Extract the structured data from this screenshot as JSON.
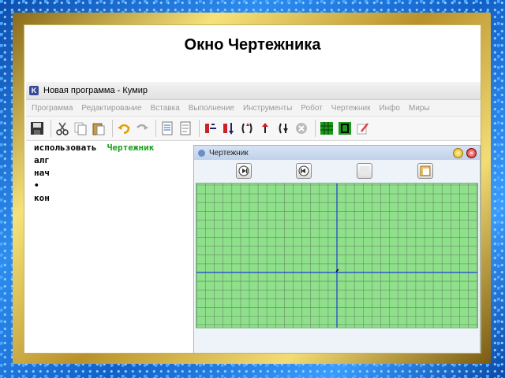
{
  "slide": {
    "title": "Окно Чертежника"
  },
  "window": {
    "title": "Новая программа - Кумир",
    "app_icon_letter": "K"
  },
  "menu": {
    "items": [
      "Программа",
      "Редактирование",
      "Вставка",
      "Выполнение",
      "Инструменты",
      "Робот",
      "Чертежник",
      "Инфо",
      "Миры"
    ]
  },
  "toolbar": {
    "icons": [
      "save-icon",
      "cut-icon",
      "copy-icon",
      "paste-icon",
      "undo-icon",
      "redo-icon",
      "indent-icon",
      "unindent-icon",
      "step-over-icon",
      "step-into-icon",
      "step-out-icon",
      "step-back-icon",
      "run-icon",
      "stop-icon",
      "robot-window-icon",
      "drawer-window-icon",
      "edit-pencil-icon"
    ]
  },
  "editor": {
    "lines": [
      {
        "keyword": "использовать",
        "arg": "Чертежник"
      },
      {
        "keyword": "алг",
        "arg": ""
      },
      {
        "keyword": "нач",
        "arg": ""
      },
      {
        "keyword": "•",
        "arg": ""
      },
      {
        "keyword": "кон",
        "arg": ""
      }
    ]
  },
  "drawer": {
    "title": "Чертежник",
    "buttons": [
      "zoom-in-icon",
      "zoom-out-icon",
      "clear-icon",
      "save-image-icon"
    ],
    "colors": {
      "canvas": "#8ee08a",
      "grid": "#6a8a6a",
      "axes": "#1c3fd0",
      "pen": "#000000"
    }
  }
}
